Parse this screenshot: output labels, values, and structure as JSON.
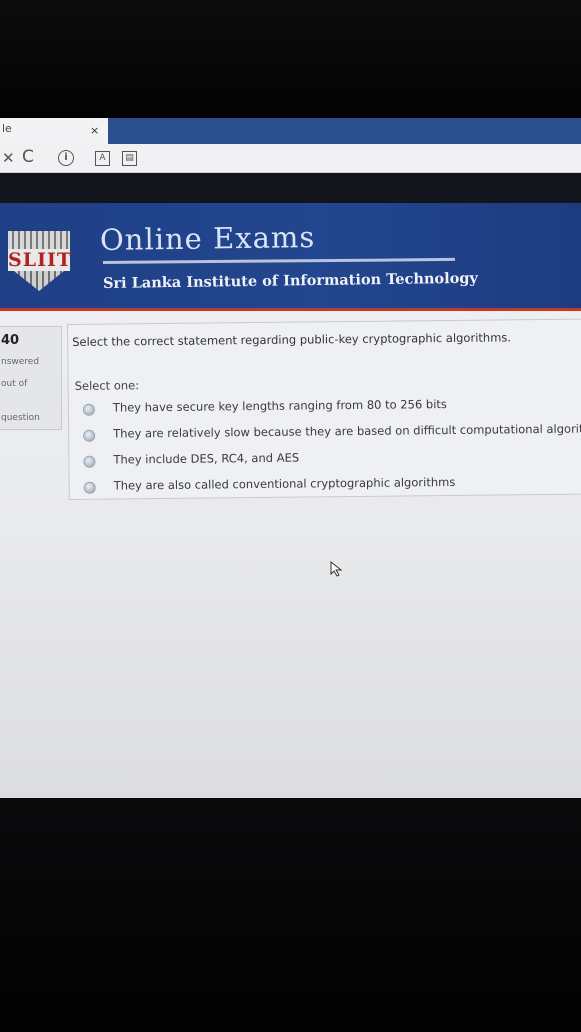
{
  "browser": {
    "tab_title": "le",
    "close_glyph": "×",
    "stop_glyph": "✕",
    "reload_glyph": "C",
    "info_glyph": "i",
    "ext1_glyph": "A",
    "ext2_glyph": "▤"
  },
  "banner": {
    "title": "Online Exams",
    "subtitle": "Sri Lanka Institute of Information Technology",
    "logo_text": "SLIIT"
  },
  "question": {
    "number": "40",
    "status_lines": [
      "nswered",
      "out of",
      "question"
    ],
    "text": "Select the correct statement regarding public-key cryptographic algorithms.",
    "prompt": "Select one:",
    "options": [
      "They have secure key lengths ranging from 80 to 256 bits",
      "They are relatively slow because they are based on difficult computational algorithm",
      "They include DES, RC4, and AES",
      "They are also called conventional cryptographic algorithms"
    ]
  },
  "colors": {
    "banner_blue": "#22468f",
    "tab_bar_blue": "#2b4f8f",
    "accent_red": "#c0392b"
  },
  "icons": [
    "close-icon",
    "stop-icon",
    "reload-icon",
    "info-icon",
    "extension-icon",
    "mouse-cursor-icon"
  ]
}
